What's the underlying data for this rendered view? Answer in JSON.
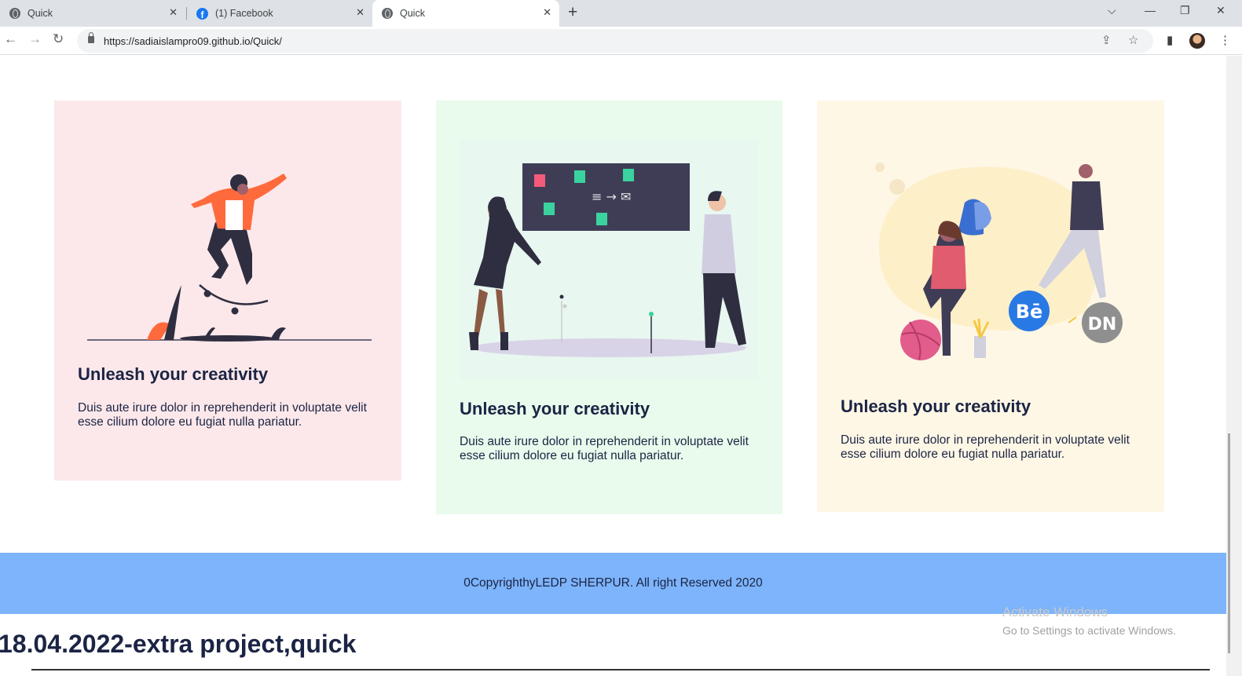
{
  "browser": {
    "tabs": [
      {
        "title": "Quick",
        "icon": "globe-icon",
        "active": false
      },
      {
        "title": "(1) Facebook",
        "icon": "facebook-icon",
        "active": false
      },
      {
        "title": "Quick",
        "icon": "globe-icon",
        "active": true
      }
    ],
    "url": "https://sadiaislampro09.github.io/Quick/"
  },
  "cards": [
    {
      "title": "Unleash your creativity",
      "text": "Duis aute irure dolor in reprehenderit in voluptate velit esse cilium dolore eu fugiat nulla pariatur.",
      "bg": "#fce8ea",
      "illustration": "skateboarder-illustration"
    },
    {
      "title": "Unleash your creativity",
      "text": "Duis aute irure dolor in reprehenderit in voluptate velit esse cilium dolore eu fugiat nulla pariatur.",
      "bg": "#e9fbec",
      "illustration": "whiteboard-meeting-illustration"
    },
    {
      "title": "Unleash your creativity",
      "text": "Duis aute irure dolor in reprehenderit in voluptate velit esse cilium dolore eu fugiat nulla pariatur.",
      "bg": "#fff7e6",
      "illustration": "social-icons-illustration",
      "badges": [
        "Bē",
        "DN"
      ]
    }
  ],
  "footer": {
    "text": "0CopyrighthyLEDP SHERPUR. All right Reserved 2020",
    "bg": "#7db4fb"
  },
  "bottom_title": "18.04.2022-extra project,quick",
  "watermark": {
    "line1": "Activate Windows",
    "line2": "Go to Settings to activate Windows."
  }
}
